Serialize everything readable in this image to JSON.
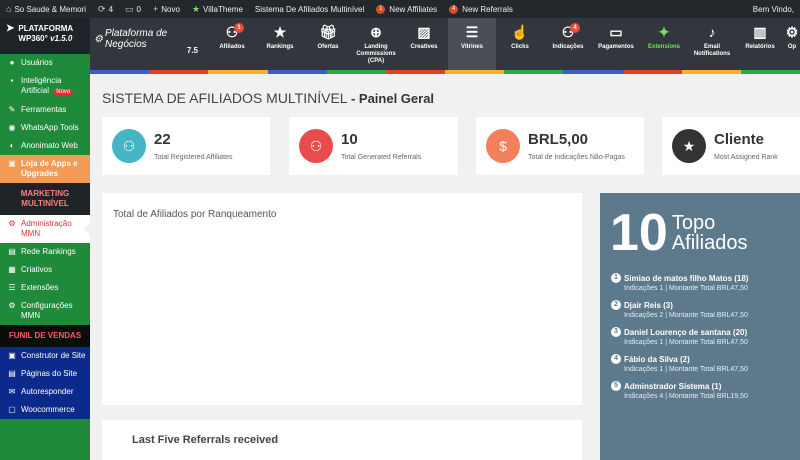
{
  "adminbar": {
    "site": "So Saude & Memori",
    "updates": "4",
    "comments": "0",
    "new": "Novo",
    "theme": "VillaTheme",
    "system": "Sistema De Afiliados Multinível",
    "affiliates_count": "1",
    "affiliates_label": "New Affiliates",
    "referrals_count": "4",
    "referrals_label": "New Referrals",
    "greeting": "Bem Vindo,"
  },
  "sidebar": {
    "brand_line1": "PLATAFORMA",
    "brand_line2": "WP360°",
    "brand_version": "v1.5.0",
    "items": [
      {
        "label": "Usuários",
        "icon": "users-icon"
      },
      {
        "label": "Inteligência Artificial",
        "icon": "chat-icon",
        "badge": "Novo"
      },
      {
        "label": "Ferramentas",
        "icon": "wrench-icon"
      },
      {
        "label": "WhatsApp Tools",
        "icon": "whatsapp-icon"
      },
      {
        "label": "Anonimato Web",
        "icon": "mask-icon"
      },
      {
        "label": "Loja de Apps e Upgrades",
        "icon": "cart-icon"
      }
    ],
    "section_mmn": "MARKETING MULTINÍVEL",
    "mmn_items": [
      {
        "label": "Administração MMN",
        "icon": "admin-icon"
      },
      {
        "label": "Rede Rankings",
        "icon": "ranking-icon"
      },
      {
        "label": "Criativos",
        "icon": "creatives-icon"
      },
      {
        "label": "Extensões",
        "icon": "extensions-icon"
      },
      {
        "label": "Configurações MMN",
        "icon": "settings-icon"
      }
    ],
    "section_funil": "FUNIL DE VENDAS",
    "funil_items": [
      {
        "label": "Construtor de Site",
        "icon": "builder-icon"
      },
      {
        "label": "Páginas do Site",
        "icon": "pages-icon"
      },
      {
        "label": "Autoresponder",
        "icon": "mail-icon"
      },
      {
        "label": "Woocommerce",
        "icon": "woo-icon"
      }
    ]
  },
  "topnav": {
    "platform": "Plataforma de Negócios",
    "version": "7.5",
    "items": [
      {
        "label": "Afiliados",
        "badge": "1"
      },
      {
        "label": "Rankings"
      },
      {
        "label": "Ofertas"
      },
      {
        "label": "Landing Commissions (CPA)"
      },
      {
        "label": "Creatives"
      },
      {
        "label": "Vitrines"
      },
      {
        "label": "Clicks"
      },
      {
        "label": "Indicações",
        "badge": "4"
      },
      {
        "label": "Pagamentos"
      },
      {
        "label": "Extensions"
      },
      {
        "label": "Email Notifications"
      },
      {
        "label": "Relatórios"
      },
      {
        "label": "Op"
      }
    ]
  },
  "page": {
    "title": "SISTEMA DE AFILIADOS MULTINÍVEL",
    "subtitle": "- Painel Geral"
  },
  "stats": [
    {
      "value": "22",
      "label": "Total Registered Affiliates",
      "color": "#45b5c4"
    },
    {
      "value": "10",
      "label": "Total Generated Referrals",
      "color": "#e84c4c"
    },
    {
      "value": "BRL5,00",
      "label": "Total de Indicações Não-Pagas",
      "color": "#f47f5b"
    },
    {
      "value": "Cliente",
      "label": "Most Assigned Rank",
      "color": "#333333"
    }
  ],
  "panels": {
    "chart_title": "Total de Afiliados por Ranqueamento",
    "last_title": "Last Five Referrals received"
  },
  "top10": {
    "number": "10",
    "word1": "Topo",
    "word2": "Afiliados",
    "items": [
      {
        "rank": "1",
        "name": "Simiao de matos filho Matos (18)",
        "meta": "Indicações 1 | Montante Total BRL47,50"
      },
      {
        "rank": "2",
        "name": "Djair Reis (3)",
        "meta": "Indicações 2 | Montante Total BRL47,50"
      },
      {
        "rank": "3",
        "name": "Daniel Lourenço de santana (20)",
        "meta": "Indicações 1 | Montante Total BRL47,50"
      },
      {
        "rank": "4",
        "name": "Fábio da Silva (2)",
        "meta": "Indicações 1 | Montante Total BRL47,50"
      },
      {
        "rank": "5",
        "name": "Adminstrador Sistema (1)",
        "meta": "Indicações 4 | Montante Total BRL19,50"
      }
    ]
  }
}
